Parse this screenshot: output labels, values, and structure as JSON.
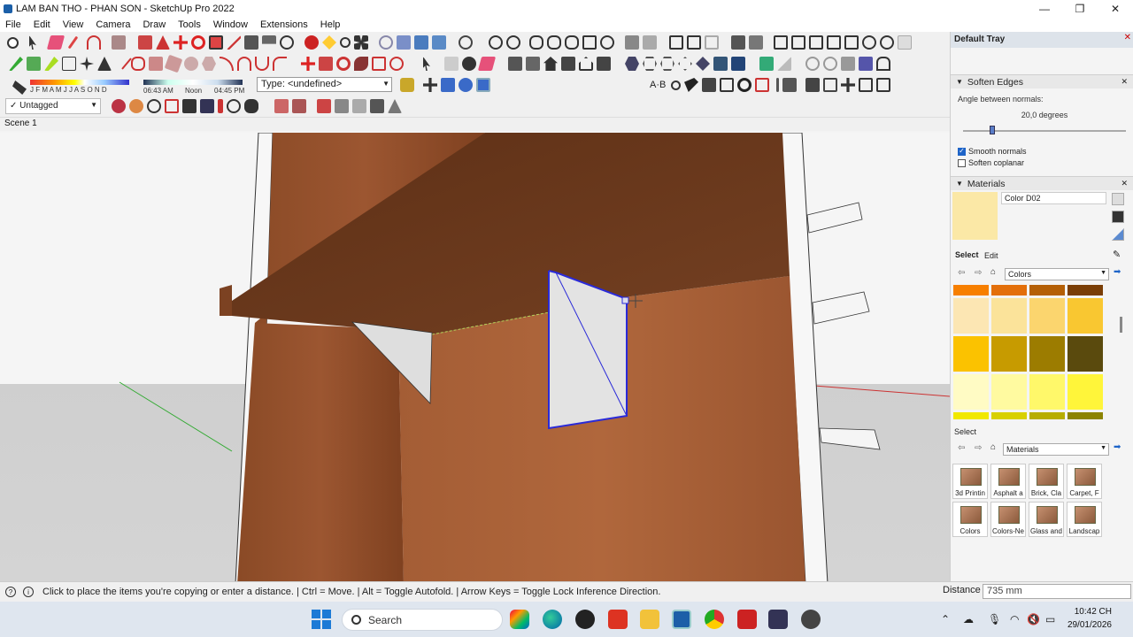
{
  "window": {
    "title": "LAM BAN THO - PHAN SON - SketchUp Pro 2022",
    "minimize": "—",
    "maximize": "❐",
    "close": "✕"
  },
  "menu": [
    "File",
    "Edit",
    "View",
    "Camera",
    "Draw",
    "Tools",
    "Window",
    "Extensions",
    "Help"
  ],
  "shadows": {
    "months": "J F M A M J J A S O N D",
    "time_start": "06:43 AM",
    "time_mid": "Noon",
    "time_end": "04:45 PM"
  },
  "type_select": "Type: <undefined>",
  "tag_select": "Untagged",
  "scene_tab": "Scene 1",
  "tray": {
    "title": "Default Tray",
    "close": "✕",
    "soften": {
      "title": "Soften Edges",
      "angle_label": "Angle between normals:",
      "angle_value": "20,0  degrees",
      "slider_fraction": 0.18,
      "smooth_normals": "Smooth normals",
      "soften_coplanar": "Soften coplanar"
    },
    "materials": {
      "title": "Materials",
      "current_name": "Color D02",
      "current_color": "#fbe8a6",
      "select_tab": "Select",
      "edit_tab": "Edit",
      "library": "Colors",
      "secondary_label": "Select",
      "secondary_library": "Materials",
      "swatches": [
        "#f77f00",
        "#e36f0a",
        "#b45f06",
        "#7a3e06",
        "#fce6b3",
        "#fbe39a",
        "#fbd56e",
        "#f9c731",
        "#fbc200",
        "#c79b00",
        "#9c7c00",
        "#5a4a0d",
        "#fffbc4",
        "#fffaa0",
        "#fff86a",
        "#fff53a",
        "#f1e800",
        "#d8d000",
        "#b7ad00",
        "#8c8400"
      ],
      "categories": [
        "3d Printin",
        "Asphalt a",
        "Brick, Cla",
        "Carpet, F",
        "Colors",
        "Colors-Ne",
        "Glass and",
        "Landscap"
      ]
    }
  },
  "status": {
    "message": "Click to place the items you're copying or enter a distance. | Ctrl = Move. | Alt = Toggle Autofold. | Arrow Keys = Toggle Lock Inference Direction.",
    "distance_label": "Distance",
    "distance_value": "735 mm"
  },
  "taskbar": {
    "search": "Search",
    "time": "10:42 CH",
    "date": "29/01/2026"
  }
}
